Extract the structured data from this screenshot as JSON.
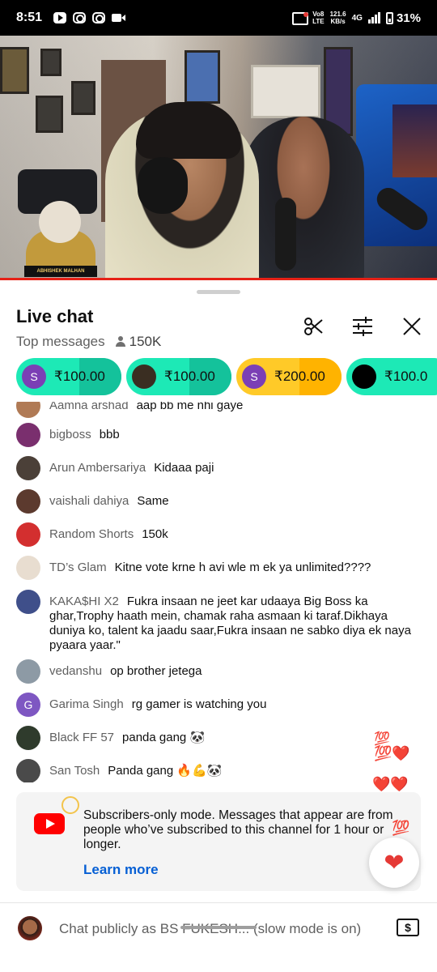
{
  "status_bar": {
    "time": "8:51",
    "net_top": "Vo8",
    "net_bottom": "LTE",
    "speed_top": "121.6",
    "speed_bottom": "KB/s",
    "network": "4G",
    "battery": "31%"
  },
  "chat": {
    "title": "Live chat",
    "mode": "Top messages",
    "viewers": "150K"
  },
  "super_chats": [
    {
      "initial": "S",
      "amount": "₹100.00",
      "bg": "#1de9b6",
      "fill": "#14c29b",
      "avatar_color": "#7b3fb5"
    },
    {
      "initial": "",
      "amount": "₹100.00",
      "bg": "#1de9b6",
      "fill": "#14c29b",
      "avatar_color": "#3a2e22"
    },
    {
      "initial": "S",
      "amount": "₹200.00",
      "bg": "#ffca28",
      "fill": "#ffb300",
      "avatar_color": "#7b3fb5"
    },
    {
      "initial": "",
      "amount": "₹100.0",
      "bg": "#1de9b6",
      "fill": "#1de9b6",
      "avatar_color": "#000000"
    }
  ],
  "messages": [
    {
      "author": "Aamna arshad",
      "text": "aap bb me nhi gaye",
      "avatar_color": "#b07a55",
      "initial": ""
    },
    {
      "author": "bigboss",
      "text": "bbb",
      "avatar_color": "#7a2f6e",
      "initial": ""
    },
    {
      "author": "Arun Ambersariya",
      "text": "Kidaaa paji",
      "avatar_color": "#4b4038",
      "initial": ""
    },
    {
      "author": "vaishali dahiya",
      "text": "Same",
      "avatar_color": "#5c3a2e",
      "initial": ""
    },
    {
      "author": "Random Shorts",
      "text": "150k",
      "avatar_color": "#d32f2f",
      "initial": ""
    },
    {
      "author": "TD’s Glam",
      "text": "Kitne vote krne h avi wle m ek ya unlimited????",
      "avatar_color": "#e8ddd0",
      "initial": ""
    },
    {
      "author": "KAKA$HI X2",
      "text": "Fukra insaan ne jeet kar udaaya Big Boss ka ghar,Trophy haath mein, chamak raha asmaan ki taraf.Dikhaya duniya ko, talent ka jaadu saar,Fukra insaan ne sabko diya ek naya pyaara yaar.\"",
      "avatar_color": "#3f4f8a",
      "initial": ""
    },
    {
      "author": "vedanshu",
      "text": "op brother jetega",
      "avatar_color": "#8d9aa5",
      "initial": ""
    },
    {
      "author": "Garima Singh",
      "text": "rg gamer is watching you",
      "avatar_color": "#7e57c2",
      "initial": "G"
    },
    {
      "author": "Black FF 57",
      "text": "panda gang 🐼",
      "avatar_color": "#2f3b2c",
      "initial": ""
    },
    {
      "author": "San Tosh",
      "text": "Panda gang 🔥💪🐼",
      "avatar_color": "#4a4a4a",
      "initial": ""
    }
  ],
  "notice": {
    "text": "Subscribers-only mode. Messages that appear are from people who’ve subscribed to this channel for 1 hour or longer.",
    "link": "Learn more"
  },
  "video_overlay_label": "ABHISHEK MALHAN",
  "input": {
    "placeholder": "Chat publicly as BS FUKESH... (slow mode is on)",
    "dollar_label": "$"
  },
  "reactions": [
    "💯",
    "💯❤️",
    "❤️❤️",
    "💯"
  ],
  "icons": {
    "clip": "scissors-icon",
    "filter": "sliders-icon",
    "close": "close-icon",
    "heart": "heart-icon"
  },
  "colors": {
    "accent_red": "#ff0000",
    "link_blue": "#065fd4"
  }
}
